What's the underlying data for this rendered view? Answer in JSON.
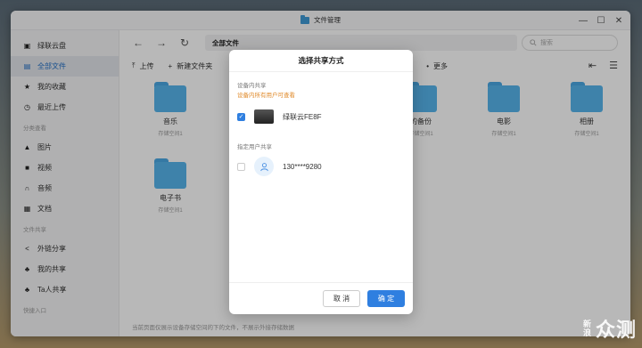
{
  "window": {
    "title": "文件管理",
    "controls": {
      "minimize": "—",
      "maximize": "☐",
      "close": "✕"
    }
  },
  "sidebar": {
    "items": [
      {
        "label": "绿联云盘",
        "icon": "▣"
      },
      {
        "label": "全部文件",
        "icon": "▤",
        "active": true
      },
      {
        "label": "我的收藏",
        "icon": "★"
      },
      {
        "label": "最近上传",
        "icon": "◷"
      }
    ],
    "section_category": "分类查看",
    "category_items": [
      {
        "label": "图片",
        "icon": "▲"
      },
      {
        "label": "视频",
        "icon": "■"
      },
      {
        "label": "音频",
        "icon": "∩"
      },
      {
        "label": "文档",
        "icon": "▦"
      }
    ],
    "section_share": "文件共享",
    "share_items": [
      {
        "label": "外链分享",
        "icon": "<"
      },
      {
        "label": "我的共享",
        "icon": "♣"
      },
      {
        "label": "Ta人共享",
        "icon": "♣"
      }
    ],
    "section_quick": "快捷入口"
  },
  "navbar": {
    "back": "←",
    "forward": "→",
    "refresh": "↻",
    "path": "全部文件",
    "search_placeholder": "搜索"
  },
  "toolbar": {
    "upload": "上传",
    "new_folder": "新建文件夹",
    "more": "更多"
  },
  "files": [
    {
      "name": "音乐",
      "meta": "存储空间1"
    },
    {
      "name": "的备份",
      "meta": "存储空间1"
    },
    {
      "name": "电影",
      "meta": "存储空间1"
    },
    {
      "name": "相册",
      "meta": "存储空间1"
    },
    {
      "name": "电子书",
      "meta": "存储空间1"
    }
  ],
  "status_text": "当前页面仅展示设备存储空间的下的文件，不展示外接存储数据",
  "dialog": {
    "title": "选择共享方式",
    "section_device": "设备内共享",
    "hint": "设备内所有用户可查看",
    "device_name": "绿联云FE8F",
    "section_user": "指定用户共享",
    "user_name": "130****9280",
    "cancel": "取 消",
    "ok": "确 定"
  },
  "watermark": {
    "small": "新浪",
    "big": "众测"
  },
  "colors": {
    "accent": "#2f7fe0",
    "folder": "#56b4ec",
    "hint": "#e08a2a"
  }
}
